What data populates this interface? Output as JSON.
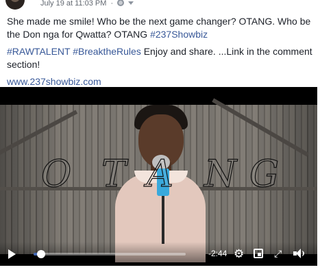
{
  "post": {
    "timestamp": "July 19 at 11:03 PM",
    "separator": "·",
    "paragraph1": "She made me smile! Who be the next game changer? OTANG. Who be the Don nga for Qwatta? OTANG #237Showbiz",
    "paragraph1_hashtag": "#237Showbiz",
    "paragraph2": "#RAWTALENT #BreaktheRules Enjoy and share. ...Link in the comment section!",
    "link": "www.237showbiz.com"
  },
  "video": {
    "title_letters": [
      "O",
      "T",
      "A",
      "N",
      "G"
    ],
    "progress": 0.05,
    "time_remaining": "-2:44",
    "icons": {
      "play": "play-icon",
      "settings": "gear-icon",
      "pip": "picture-in-picture-icon",
      "fullscreen": "fullscreen-icon",
      "volume": "volume-icon"
    }
  },
  "colors": {
    "link": "#385898",
    "progress": "#4267b2",
    "text": "#1d2129",
    "meta": "#616770"
  }
}
